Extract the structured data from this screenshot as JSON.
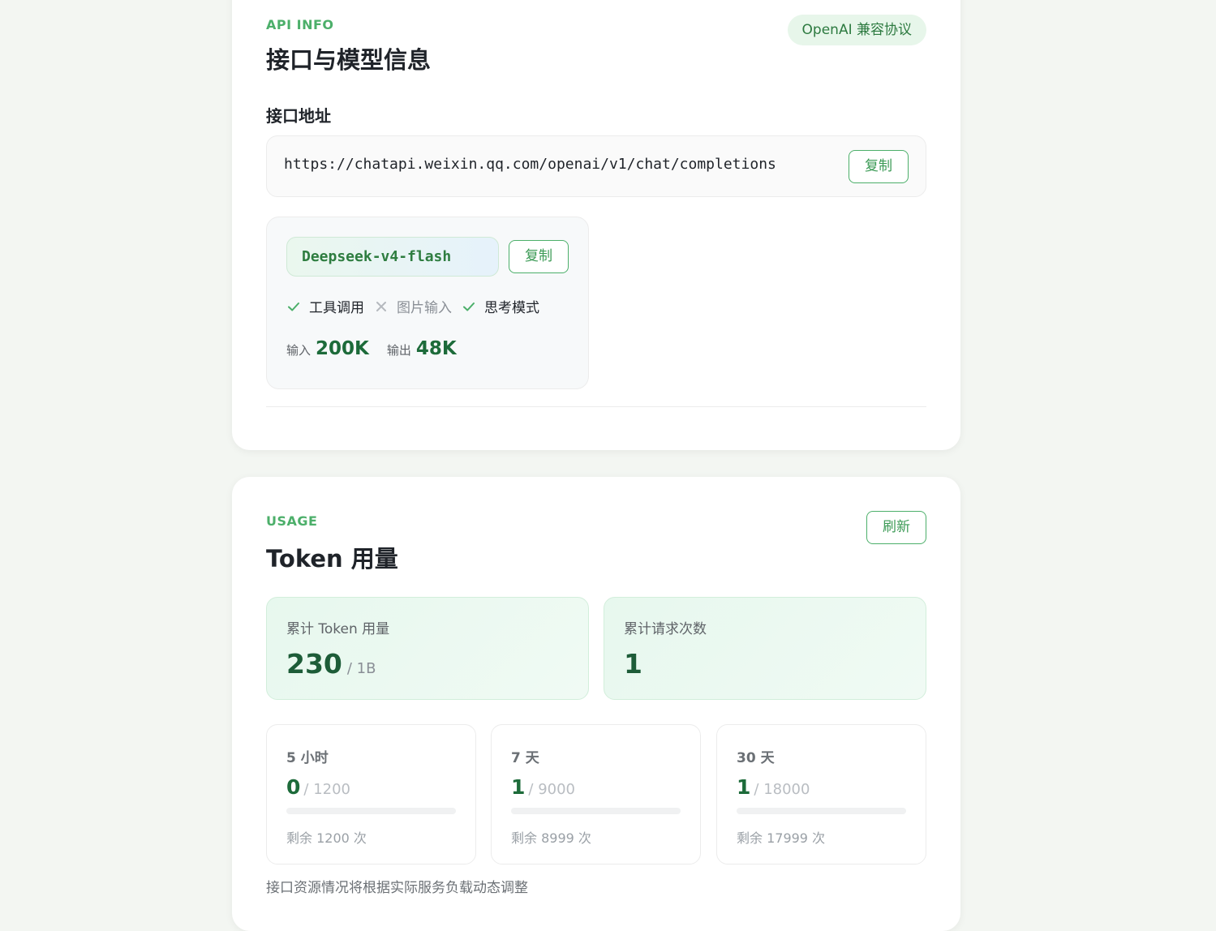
{
  "api": {
    "eyebrow": "API INFO",
    "title": "接口与模型信息",
    "protocol_badge": "OpenAI 兼容协议",
    "endpoint_label": "接口地址",
    "endpoint_url": "https://chatapi.weixin.qq.com/openai/v1/chat/completions",
    "copy_label": "复制",
    "model": {
      "name": "Deepseek-v4-flash",
      "copy_label": "复制",
      "features": [
        {
          "label": "工具调用",
          "enabled": true,
          "icon": "check-icon"
        },
        {
          "label": "图片输入",
          "enabled": false,
          "icon": "cross-icon"
        },
        {
          "label": "思考模式",
          "enabled": true,
          "icon": "check-icon"
        }
      ],
      "input_label": "输入",
      "input_value": "200K",
      "output_label": "输出",
      "output_value": "48K"
    }
  },
  "usage": {
    "eyebrow": "USAGE",
    "title": "Token 用量",
    "refresh_label": "刷新",
    "total_tokens": {
      "label": "累计 Token 用量",
      "value": "230",
      "limit": "/ 1B"
    },
    "total_requests": {
      "label": "累计请求次数",
      "value": "1"
    },
    "quotas": [
      {
        "label": "5 小时",
        "used": "0",
        "limit": "/ 1200",
        "remaining": "剩余 1200 次",
        "fraction": 0.0
      },
      {
        "label": "7 天",
        "used": "1",
        "limit": "/ 9000",
        "remaining": "剩余 8999 次",
        "fraction": 0.000111
      },
      {
        "label": "30 天",
        "used": "1",
        "limit": "/ 18000",
        "remaining": "剩余 17999 次",
        "fraction": 5.56e-05
      }
    ],
    "footnote": "接口资源情况将根据实际服务负载动态调整"
  },
  "colors": {
    "accent": "#4caf6a",
    "accent_dark": "#1d6b3a",
    "page_bg": "#f3f6f2"
  }
}
